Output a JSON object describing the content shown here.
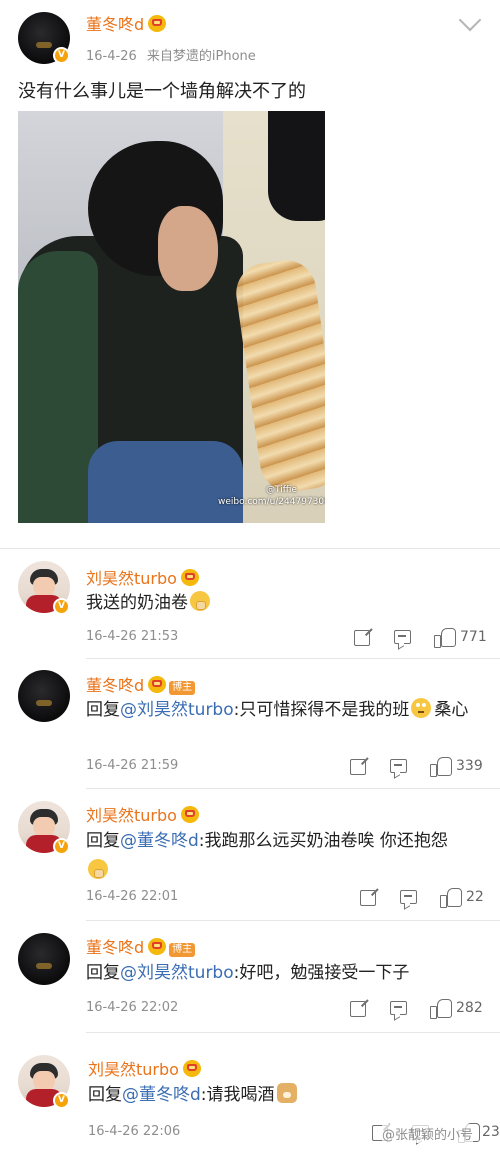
{
  "post": {
    "author": "董冬咚d",
    "date": "16-4-26",
    "source": "来自梦遗的iPhone",
    "text": "没有什么事儿是一个墙角解决不了的",
    "image_watermark_site": "weibo.com/u/2447973003",
    "image_watermark_user": "@Tiffie"
  },
  "host_tag": "博主",
  "v_badge": "V",
  "comments": [
    {
      "author": "刘昊然turbo",
      "text": "我送的奶油卷",
      "emoji": "shush-emoji",
      "time": "16-4-26 21:53",
      "likes": "771",
      "avatar": "kid",
      "is_host": false
    },
    {
      "author": "董冬咚d",
      "reply_prefix": "回复",
      "mention": "@刘昊然turbo",
      "text": ":只可惜探得不是我的班",
      "emoji": "eyeroll-emoji",
      "text_after": "桑心",
      "time": "16-4-26 21:59",
      "likes": "339",
      "avatar": "dark",
      "is_host": true
    },
    {
      "author": "刘昊然turbo",
      "reply_prefix": "回复",
      "mention": "@董冬咚d",
      "text": ":我跑那么远买奶油卷唉 你还抱怨",
      "emoji": "shush-emoji",
      "time": "16-4-26 22:01",
      "likes": "22",
      "avatar": "kid",
      "is_host": false
    },
    {
      "author": "董冬咚d",
      "reply_prefix": "回复",
      "mention": "@刘昊然turbo",
      "text": ":好吧，勉强接受一下子",
      "time": "16-4-26 22:02",
      "likes": "282",
      "avatar": "dark",
      "is_host": true
    },
    {
      "author": "刘昊然turbo",
      "reply_prefix": "回复",
      "mention": "@董冬咚d",
      "text": ":请我喝酒",
      "emoji": "doge-emoji",
      "time": "16-4-26 22:06",
      "likes": "23",
      "avatar": "kid",
      "is_host": false
    }
  ],
  "page_watermark": "@张靓颖的小号",
  "colors": {
    "name": "#e9741c",
    "mention": "#3a6db3",
    "meta": "#8e8e8e",
    "host_tag": "#f19733",
    "v_badge": "#f6a20a"
  }
}
